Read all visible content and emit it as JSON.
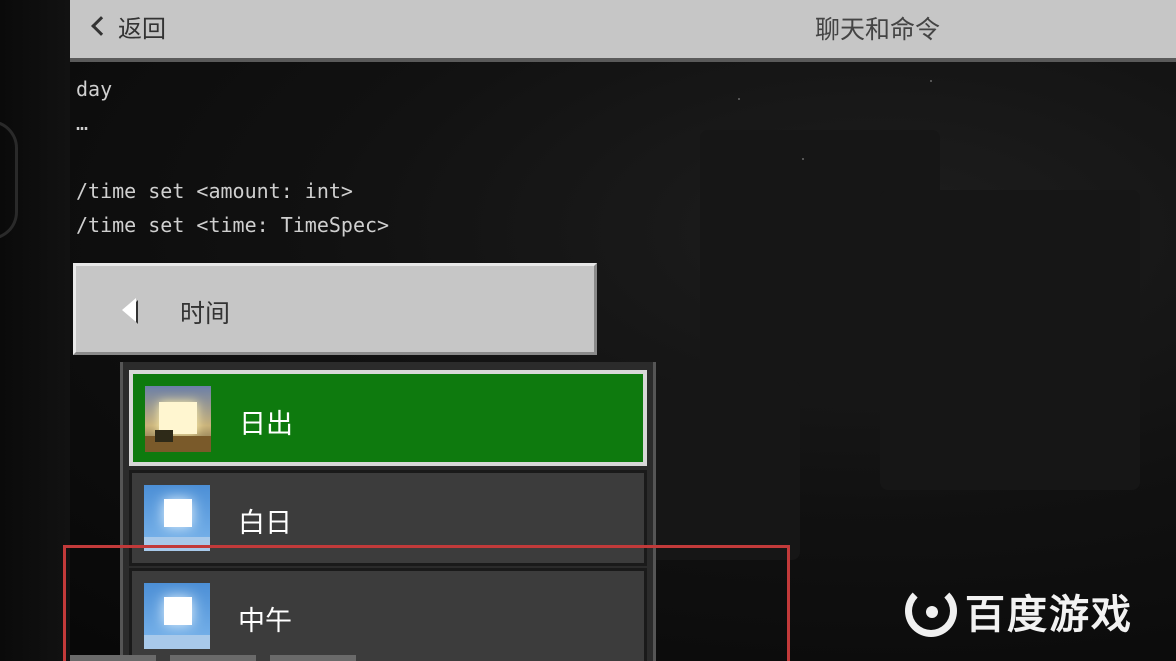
{
  "header": {
    "back_label": "返回",
    "title": "聊天和命令"
  },
  "output": {
    "lines": [
      "day",
      "…",
      "",
      "/time set <amount: int>",
      "/time set <time: TimeSpec>"
    ]
  },
  "time_selector": {
    "label": "时间"
  },
  "time_options": [
    {
      "label": "日出",
      "icon": "sunrise-icon",
      "selected": true
    },
    {
      "label": "白日",
      "icon": "day-sun-icon",
      "selected": false
    },
    {
      "label": "中午",
      "icon": "noon-sun-icon",
      "selected": false
    }
  ],
  "watermark": {
    "text": "百度游戏"
  },
  "colors": {
    "selected_green": "#0e7a0e",
    "highlight_red": "#c23a3a",
    "panel_gray": "#c6c6c6"
  }
}
